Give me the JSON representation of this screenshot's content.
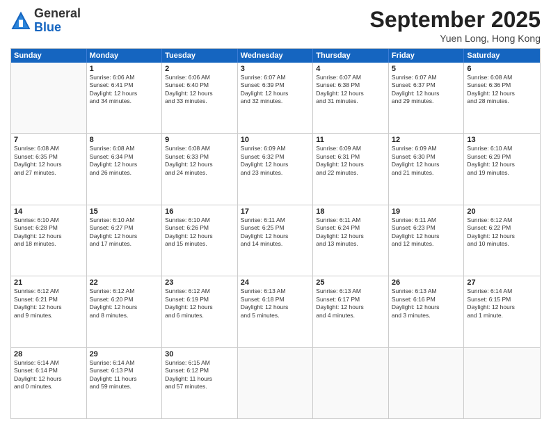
{
  "logo": {
    "general": "General",
    "blue": "Blue"
  },
  "title": "September 2025",
  "location": "Yuen Long, Hong Kong",
  "header_days": [
    "Sunday",
    "Monday",
    "Tuesday",
    "Wednesday",
    "Thursday",
    "Friday",
    "Saturday"
  ],
  "rows": [
    [
      {
        "day": "",
        "lines": []
      },
      {
        "day": "1",
        "lines": [
          "Sunrise: 6:06 AM",
          "Sunset: 6:41 PM",
          "Daylight: 12 hours",
          "and 34 minutes."
        ]
      },
      {
        "day": "2",
        "lines": [
          "Sunrise: 6:06 AM",
          "Sunset: 6:40 PM",
          "Daylight: 12 hours",
          "and 33 minutes."
        ]
      },
      {
        "day": "3",
        "lines": [
          "Sunrise: 6:07 AM",
          "Sunset: 6:39 PM",
          "Daylight: 12 hours",
          "and 32 minutes."
        ]
      },
      {
        "day": "4",
        "lines": [
          "Sunrise: 6:07 AM",
          "Sunset: 6:38 PM",
          "Daylight: 12 hours",
          "and 31 minutes."
        ]
      },
      {
        "day": "5",
        "lines": [
          "Sunrise: 6:07 AM",
          "Sunset: 6:37 PM",
          "Daylight: 12 hours",
          "and 29 minutes."
        ]
      },
      {
        "day": "6",
        "lines": [
          "Sunrise: 6:08 AM",
          "Sunset: 6:36 PM",
          "Daylight: 12 hours",
          "and 28 minutes."
        ]
      }
    ],
    [
      {
        "day": "7",
        "lines": [
          "Sunrise: 6:08 AM",
          "Sunset: 6:35 PM",
          "Daylight: 12 hours",
          "and 27 minutes."
        ]
      },
      {
        "day": "8",
        "lines": [
          "Sunrise: 6:08 AM",
          "Sunset: 6:34 PM",
          "Daylight: 12 hours",
          "and 26 minutes."
        ]
      },
      {
        "day": "9",
        "lines": [
          "Sunrise: 6:08 AM",
          "Sunset: 6:33 PM",
          "Daylight: 12 hours",
          "and 24 minutes."
        ]
      },
      {
        "day": "10",
        "lines": [
          "Sunrise: 6:09 AM",
          "Sunset: 6:32 PM",
          "Daylight: 12 hours",
          "and 23 minutes."
        ]
      },
      {
        "day": "11",
        "lines": [
          "Sunrise: 6:09 AM",
          "Sunset: 6:31 PM",
          "Daylight: 12 hours",
          "and 22 minutes."
        ]
      },
      {
        "day": "12",
        "lines": [
          "Sunrise: 6:09 AM",
          "Sunset: 6:30 PM",
          "Daylight: 12 hours",
          "and 21 minutes."
        ]
      },
      {
        "day": "13",
        "lines": [
          "Sunrise: 6:10 AM",
          "Sunset: 6:29 PM",
          "Daylight: 12 hours",
          "and 19 minutes."
        ]
      }
    ],
    [
      {
        "day": "14",
        "lines": [
          "Sunrise: 6:10 AM",
          "Sunset: 6:28 PM",
          "Daylight: 12 hours",
          "and 18 minutes."
        ]
      },
      {
        "day": "15",
        "lines": [
          "Sunrise: 6:10 AM",
          "Sunset: 6:27 PM",
          "Daylight: 12 hours",
          "and 17 minutes."
        ]
      },
      {
        "day": "16",
        "lines": [
          "Sunrise: 6:10 AM",
          "Sunset: 6:26 PM",
          "Daylight: 12 hours",
          "and 15 minutes."
        ]
      },
      {
        "day": "17",
        "lines": [
          "Sunrise: 6:11 AM",
          "Sunset: 6:25 PM",
          "Daylight: 12 hours",
          "and 14 minutes."
        ]
      },
      {
        "day": "18",
        "lines": [
          "Sunrise: 6:11 AM",
          "Sunset: 6:24 PM",
          "Daylight: 12 hours",
          "and 13 minutes."
        ]
      },
      {
        "day": "19",
        "lines": [
          "Sunrise: 6:11 AM",
          "Sunset: 6:23 PM",
          "Daylight: 12 hours",
          "and 12 minutes."
        ]
      },
      {
        "day": "20",
        "lines": [
          "Sunrise: 6:12 AM",
          "Sunset: 6:22 PM",
          "Daylight: 12 hours",
          "and 10 minutes."
        ]
      }
    ],
    [
      {
        "day": "21",
        "lines": [
          "Sunrise: 6:12 AM",
          "Sunset: 6:21 PM",
          "Daylight: 12 hours",
          "and 9 minutes."
        ]
      },
      {
        "day": "22",
        "lines": [
          "Sunrise: 6:12 AM",
          "Sunset: 6:20 PM",
          "Daylight: 12 hours",
          "and 8 minutes."
        ]
      },
      {
        "day": "23",
        "lines": [
          "Sunrise: 6:12 AM",
          "Sunset: 6:19 PM",
          "Daylight: 12 hours",
          "and 6 minutes."
        ]
      },
      {
        "day": "24",
        "lines": [
          "Sunrise: 6:13 AM",
          "Sunset: 6:18 PM",
          "Daylight: 12 hours",
          "and 5 minutes."
        ]
      },
      {
        "day": "25",
        "lines": [
          "Sunrise: 6:13 AM",
          "Sunset: 6:17 PM",
          "Daylight: 12 hours",
          "and 4 minutes."
        ]
      },
      {
        "day": "26",
        "lines": [
          "Sunrise: 6:13 AM",
          "Sunset: 6:16 PM",
          "Daylight: 12 hours",
          "and 3 minutes."
        ]
      },
      {
        "day": "27",
        "lines": [
          "Sunrise: 6:14 AM",
          "Sunset: 6:15 PM",
          "Daylight: 12 hours",
          "and 1 minute."
        ]
      }
    ],
    [
      {
        "day": "28",
        "lines": [
          "Sunrise: 6:14 AM",
          "Sunset: 6:14 PM",
          "Daylight: 12 hours",
          "and 0 minutes."
        ]
      },
      {
        "day": "29",
        "lines": [
          "Sunrise: 6:14 AM",
          "Sunset: 6:13 PM",
          "Daylight: 11 hours",
          "and 59 minutes."
        ]
      },
      {
        "day": "30",
        "lines": [
          "Sunrise: 6:15 AM",
          "Sunset: 6:12 PM",
          "Daylight: 11 hours",
          "and 57 minutes."
        ]
      },
      {
        "day": "",
        "lines": []
      },
      {
        "day": "",
        "lines": []
      },
      {
        "day": "",
        "lines": []
      },
      {
        "day": "",
        "lines": []
      }
    ]
  ]
}
